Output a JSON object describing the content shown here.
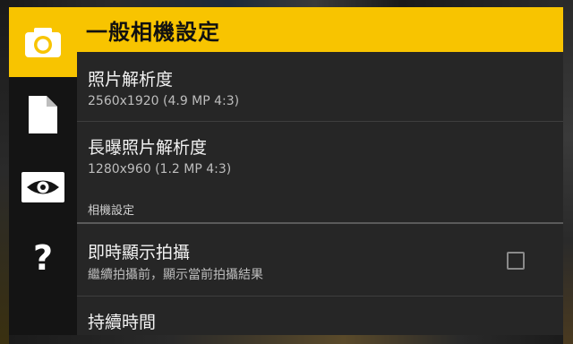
{
  "header": {
    "title": "一般相機設定"
  },
  "sidebar": {
    "items": [
      {
        "icon": "camera-icon",
        "active": true
      },
      {
        "icon": "document-icon",
        "active": false
      },
      {
        "icon": "eye-icon",
        "active": false
      },
      {
        "icon": "question-icon",
        "label": "?",
        "active": false
      }
    ]
  },
  "settings": {
    "photo_resolution": {
      "title": "照片解析度",
      "value": "2560x1920 (4.9 MP 4:3)"
    },
    "long_exposure_resolution": {
      "title": "長曝照片解析度",
      "value": "1280x960 (1.2 MP 4:3)"
    },
    "section_camera": {
      "label": "相機設定"
    },
    "live_preview": {
      "title": "即時顯示拍攝",
      "summary": "繼續拍攝前，顯示當前拍攝結果",
      "checked": false
    },
    "duration": {
      "title": "持續時間"
    }
  },
  "colors": {
    "accent": "#f8c400",
    "panel": "#262626",
    "sidebar": "#141414"
  }
}
